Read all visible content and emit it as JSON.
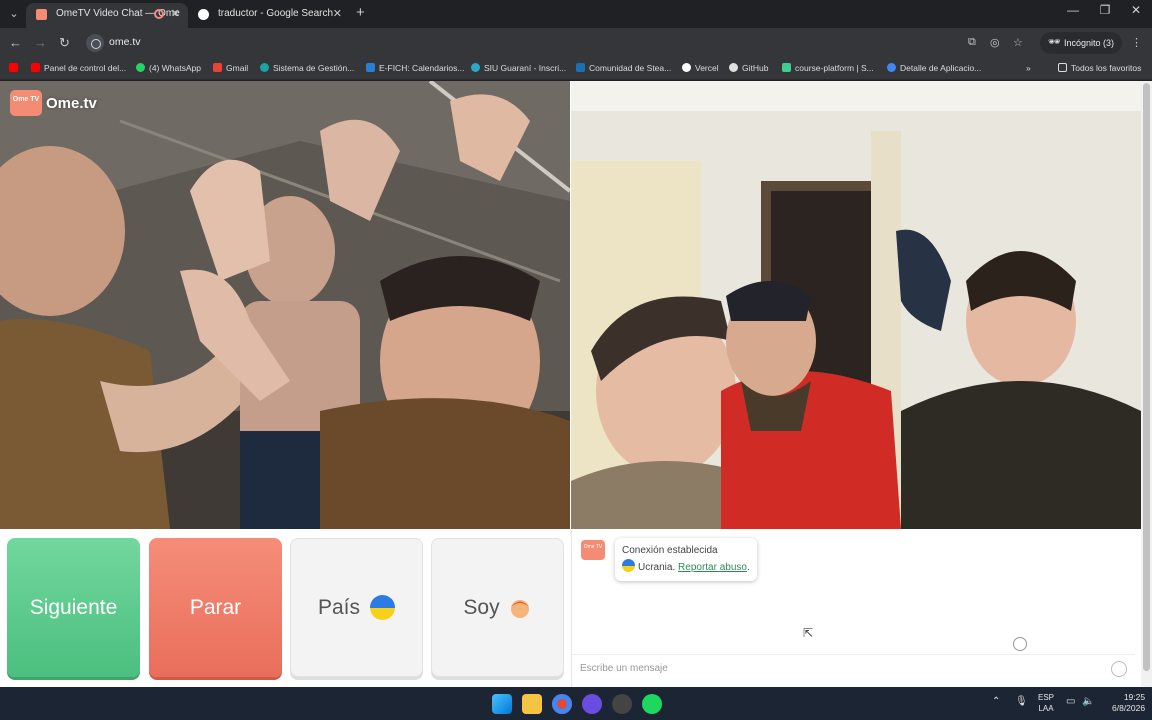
{
  "browser": {
    "tabs": [
      {
        "title": "OmeTV Video Chat — Ome",
        "active": true
      },
      {
        "title": "traductor - Google Search",
        "active": false
      }
    ],
    "url": "ome.tv",
    "incognito_label": "Incógnito (3)",
    "bookmarks": [
      "Panel de control del...",
      "(4) WhatsApp",
      "Gmail",
      "Sistema de Gestión...",
      "E-FICH: Calendarios...",
      "SIU Guaraní - Inscri...",
      "Comunidad de Stea...",
      "Vercel",
      "GitHub",
      "course-platform | S...",
      "Detalle de Aplicacio..."
    ],
    "all_bookmarks_label": "Todos los favoritos"
  },
  "app": {
    "logo_text": "Ome.tv",
    "logo_badge": "Ome TV",
    "buttons": {
      "next": "Siguiente",
      "stop": "Parar",
      "country": "País",
      "gender": "Soy"
    },
    "chat": {
      "status": "Conexión establecida",
      "country": "Ucrania.",
      "report": "Reportar abuso",
      "report_suffix": ".",
      "input_placeholder": "Escribe un mensaje"
    }
  },
  "taskbar": {
    "lang_top": "ESP",
    "lang_bottom": "LAA",
    "time": "19:25",
    "date": "6/8/2026"
  },
  "colors": {
    "next_button": "#5cc98d",
    "stop_button": "#ee7b66",
    "ukraine_blue": "#2c7be5",
    "ukraine_yellow": "#f7d117",
    "report_link": "#2e8b57"
  }
}
